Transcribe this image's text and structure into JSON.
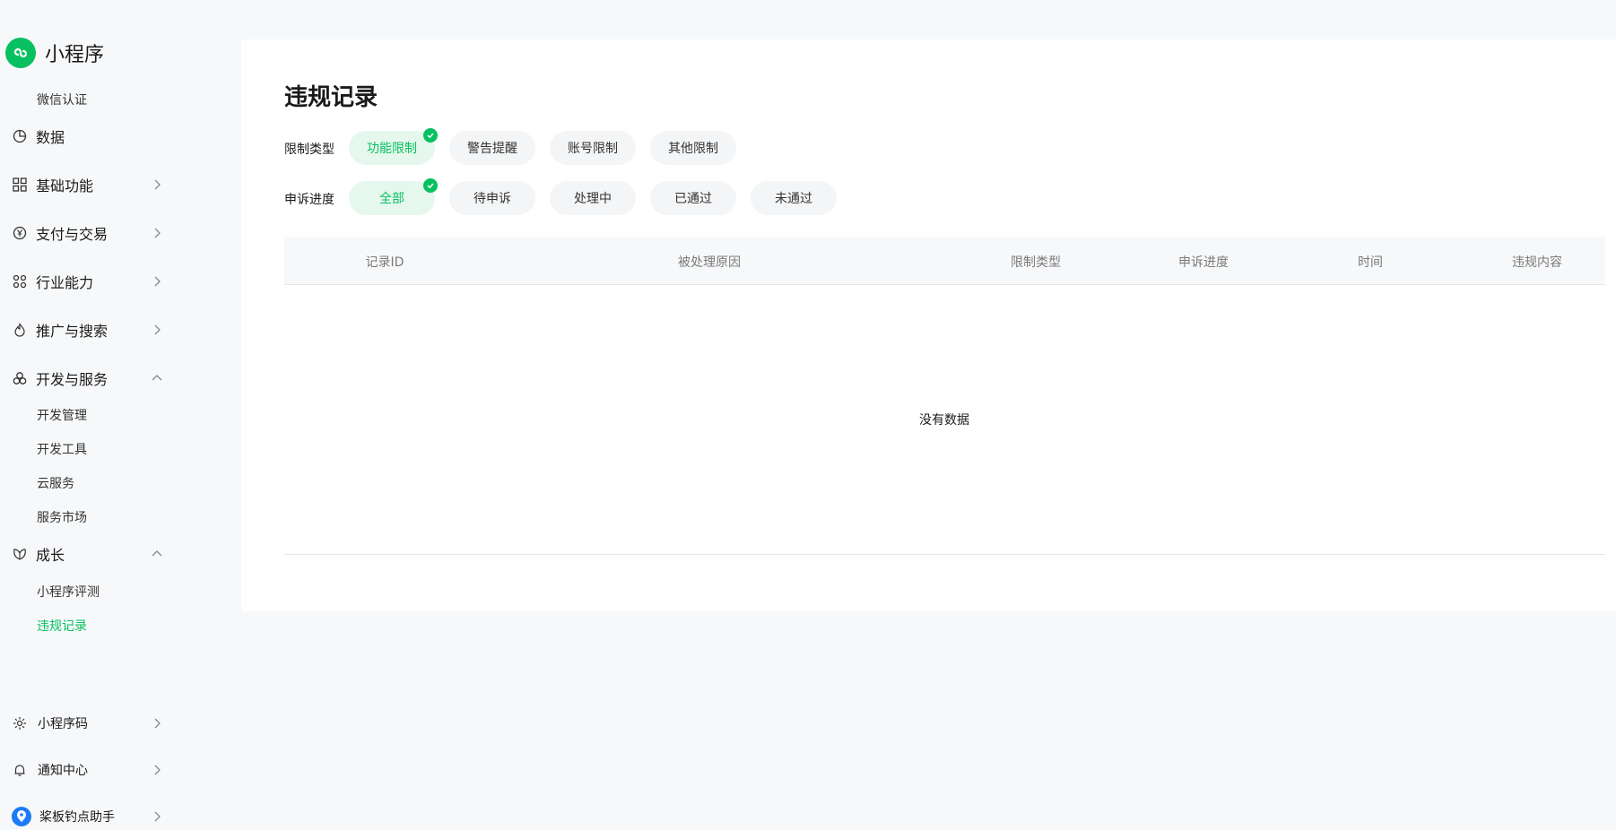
{
  "sidebar": {
    "brand_title": "小程序",
    "wechat_verify": "微信认证",
    "data": "数据",
    "basic": "基础功能",
    "payment": "支付与交易",
    "industry": "行业能力",
    "promotion": "推广与搜索",
    "dev": "开发与服务",
    "dev_sub": [
      "开发管理",
      "开发工具",
      "云服务",
      "服务市场"
    ],
    "growth": "成长",
    "growth_sub": [
      "小程序评测",
      "违规记录"
    ],
    "qrcode": "小程序码",
    "notify": "通知中心",
    "helper": "桨板钓点助手"
  },
  "main": {
    "title": "违规记录",
    "filter1": {
      "label": "限制类型",
      "options": [
        "功能限制",
        "警告提醒",
        "账号限制",
        "其他限制"
      ],
      "selected": "功能限制"
    },
    "filter2": {
      "label": "申诉进度",
      "options": [
        "全部",
        "待申诉",
        "处理中",
        "已通过",
        "未通过"
      ],
      "selected": "全部"
    },
    "table": {
      "columns": [
        "记录ID",
        "被处理原因",
        "限制类型",
        "申诉进度",
        "时间",
        "违规内容"
      ],
      "empty": "没有数据"
    }
  },
  "colors": {
    "accent": "#07c160",
    "selected_chip_bg": "#e6f7ee",
    "chip_bg": "#f4f5f6"
  }
}
